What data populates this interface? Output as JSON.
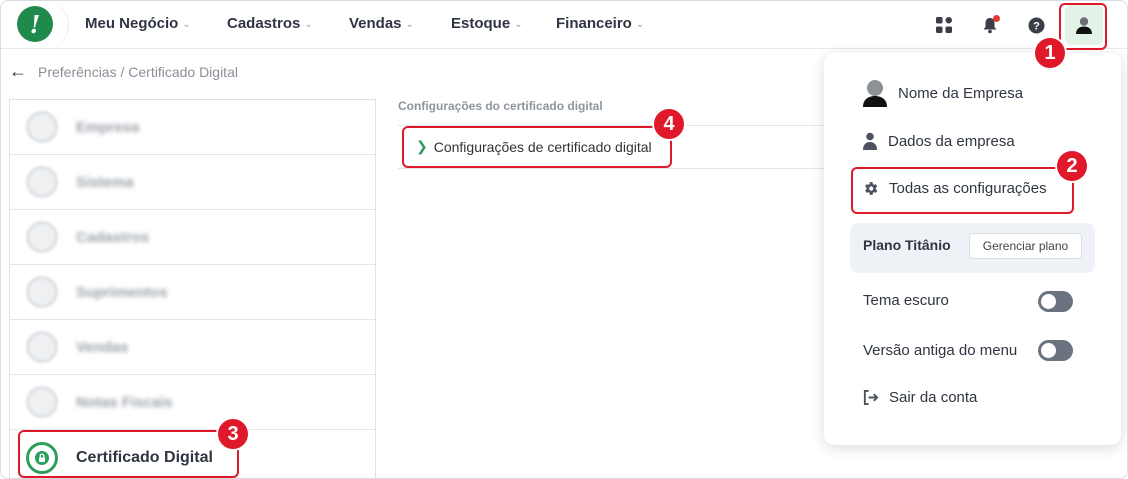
{
  "topnav": {
    "logo_letter": "!",
    "items": [
      {
        "label": "Meu Negócio"
      },
      {
        "label": "Cadastros"
      },
      {
        "label": "Vendas"
      },
      {
        "label": "Estoque"
      },
      {
        "label": "Financeiro"
      }
    ],
    "icons": [
      "apps-grid-icon",
      "bell-icon",
      "help-icon",
      "user-avatar-icon"
    ]
  },
  "breadcrumb": "Preferências / Certificado Digital",
  "left_menu": {
    "items": [
      {
        "label": "Empresa"
      },
      {
        "label": "Sistema"
      },
      {
        "label": "Cadastros"
      },
      {
        "label": "Suprimentos"
      },
      {
        "label": "Vendas"
      },
      {
        "label": "Notas Fiscais"
      },
      {
        "label": "Certificado Digital",
        "active": true
      }
    ]
  },
  "content": {
    "section_title": "Configurações do certificado digital",
    "link_label": "Configurações de certificado digital"
  },
  "dropdown": {
    "company_name": "Nome da Empresa",
    "company_data": "Dados da empresa",
    "all_settings": "Todas as configurações",
    "plan_name": "Plano Titânio",
    "plan_button": "Gerenciar plano",
    "dark_theme": "Tema escuro",
    "old_menu": "Versão antiga do menu",
    "logout": "Sair da conta"
  },
  "annotations": [
    "1",
    "2",
    "3",
    "4"
  ],
  "colors": {
    "accent_green": "#2e9e5b",
    "annotation_red": "#e0192a",
    "notification_dot": "#e53935"
  }
}
